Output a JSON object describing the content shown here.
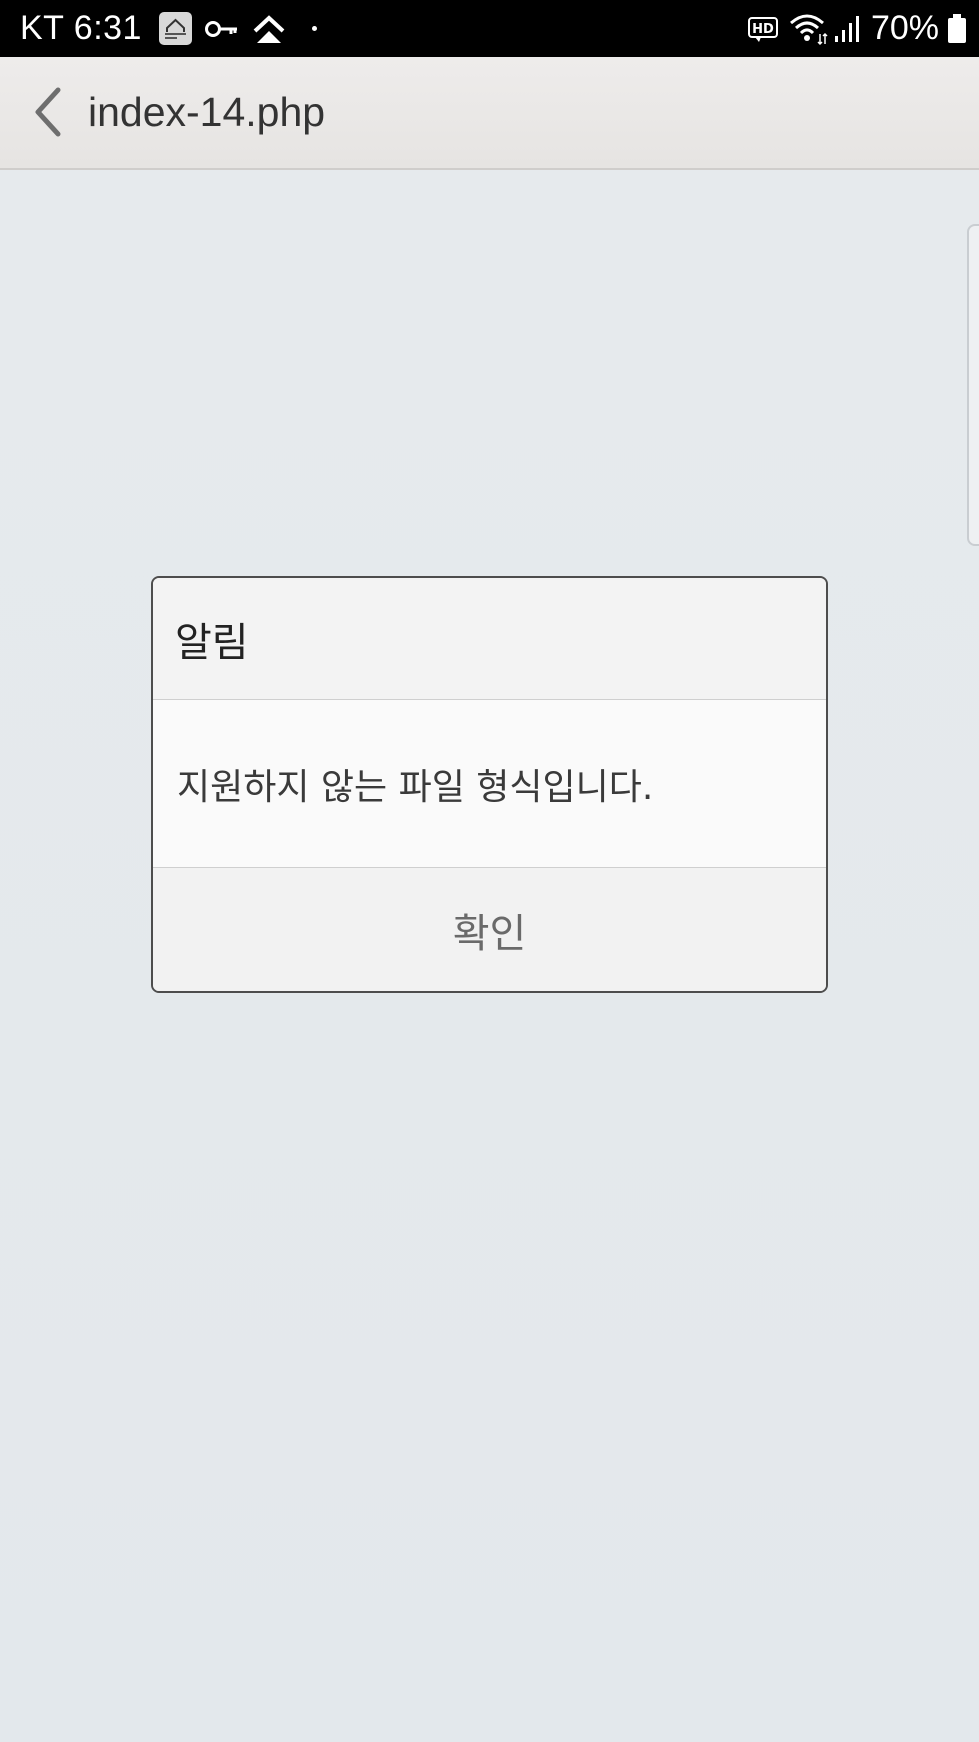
{
  "status_bar": {
    "carrier_time": "KT 6:31",
    "battery_percent": "70%",
    "icons": [
      "smartcam-icon",
      "key-icon",
      "vpn-icon",
      "dot-icon",
      "hd-icon",
      "wifi-icon",
      "signal-icon",
      "battery-icon"
    ]
  },
  "app_bar": {
    "title": "index-14.php",
    "back_icon": "chevron-left-icon"
  },
  "dialog": {
    "title": "알림",
    "message": "지원하지 않는 파일 형식입니다.",
    "confirm_label": "확인"
  },
  "colors": {
    "status_bar_bg": "#000000",
    "app_bar_bg": "#eceae8",
    "content_bg": "#e5e9ec",
    "dialog_border": "#4d4d4d"
  }
}
